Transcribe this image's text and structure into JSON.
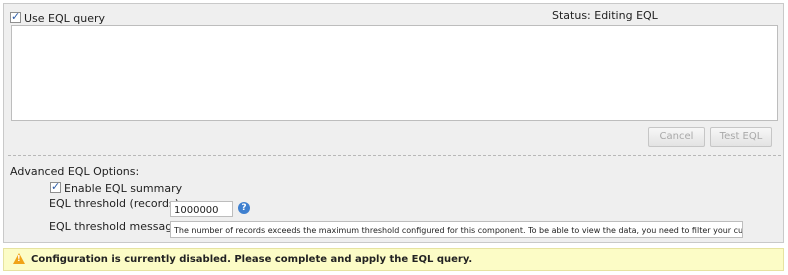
{
  "query": {
    "use_eql_label": "Use EQL query",
    "use_eql_checked": true,
    "status_text": "Status: Editing EQL",
    "editor_value": ""
  },
  "buttons": {
    "cancel_label": "Cancel",
    "test_label": "Test EQL"
  },
  "advanced": {
    "title": "Advanced EQL Options:",
    "enable_summary_label": "Enable EQL summary",
    "enable_summary_checked": true,
    "threshold_label": "EQL threshold (records):",
    "threshold_value": "1000000",
    "threshold_help_icon": "help-icon",
    "message_label": "EQL threshold message:",
    "message_value": "The number of records exceeds the maximum threshold configured for this component.  To be able to view the data, you need to filter your current"
  },
  "warning": {
    "icon": "warning-icon",
    "text": "Configuration is currently disabled. Please complete and apply the EQL query."
  },
  "colors": {
    "panel_bg": "#efefef",
    "warning_bg": "#fcfcc6",
    "warning_icon": "#f0a318",
    "help_icon": "#3f80cf",
    "check": "#2d5da8"
  }
}
